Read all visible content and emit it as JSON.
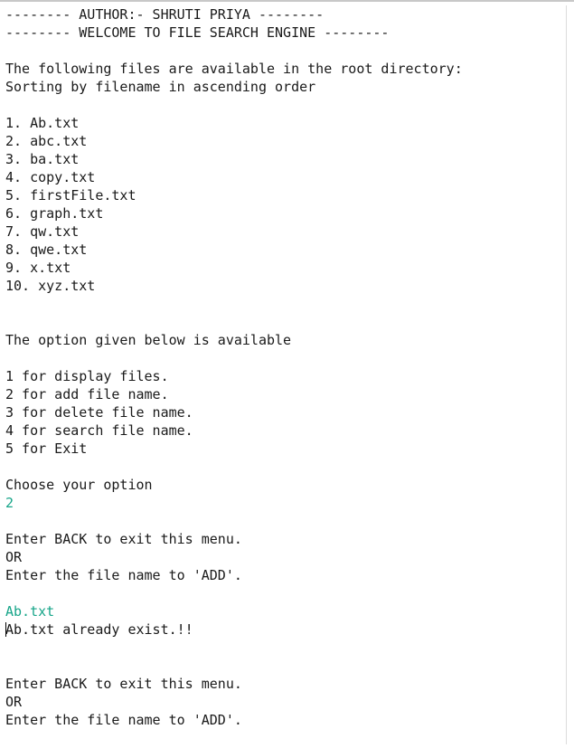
{
  "header": {
    "author_line": "-------- AUTHOR:- SHRUTI PRIYA --------",
    "welcome_line": "-------- WELCOME TO FILE SEARCH ENGINE --------"
  },
  "intro": {
    "line1": "The following files are available in the root directory:",
    "line2": "Sorting by filename in ascending order"
  },
  "files": [
    "1. Ab.txt",
    "2. abc.txt",
    "3. ba.txt",
    "4. copy.txt",
    "5. firstFile.txt",
    "6. graph.txt",
    "7. qw.txt",
    "8. qwe.txt",
    "9. x.txt",
    "10. xyz.txt"
  ],
  "options": {
    "heading": "The option given below is available",
    "items": [
      "1 for display files.",
      "2 for add file name.",
      "3 for delete file name.",
      "4 for search file name.",
      "5 for Exit"
    ],
    "prompt": "Choose your option",
    "user_choice": "2"
  },
  "add_menu": {
    "back_hint": "Enter BACK to exit this menu.",
    "or_text": "OR",
    "add_prompt": "Enter the file name to 'ADD'."
  },
  "session": {
    "user_entry": "Ab.txt",
    "result_message": "Ab.txt already exist.!!"
  },
  "add_menu_repeat": {
    "back_hint": "Enter BACK to exit this menu.",
    "or_text": "OR",
    "add_prompt": "Enter the file name to 'ADD'."
  }
}
